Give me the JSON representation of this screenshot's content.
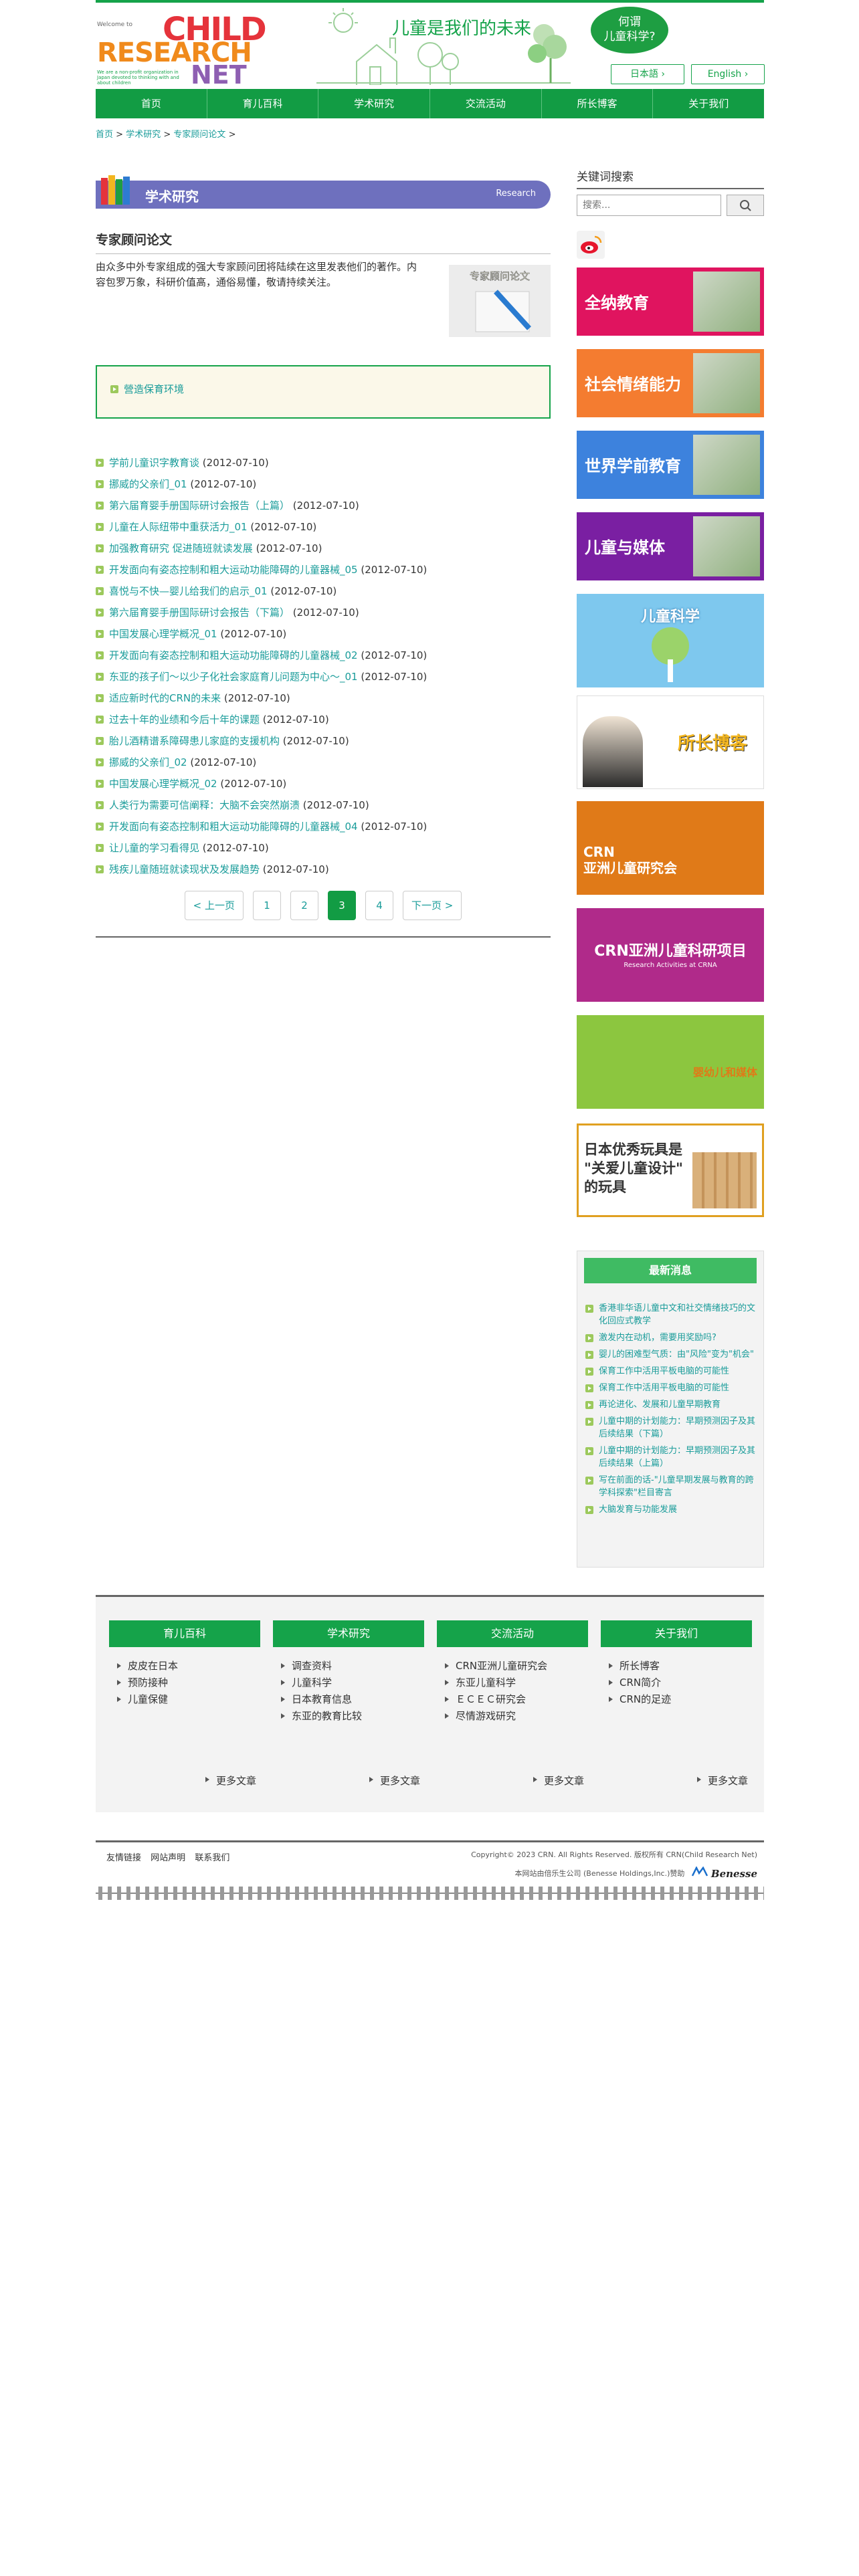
{
  "header": {
    "welcome": "Welcome to",
    "logo_line1": "CHILD",
    "logo_line2": "RESEARCH",
    "logo_line3": "NET",
    "tagline": "We are a non-profit organization in Japan devoted to thinking with and about children",
    "slogan": "儿童是我们的未来",
    "bubble": "何谓\n儿童科学?",
    "lang_jp": "日本語",
    "lang_en": "English"
  },
  "nav": [
    "首页",
    "育儿百科",
    "学术研究",
    "交流活动",
    "所长博客",
    "关于我们"
  ],
  "breadcrumb": {
    "home": "首页",
    "academic": "学术研究",
    "current": "专家顾问论文",
    "sep": ">"
  },
  "section": {
    "title": "学术研究",
    "title_en": "Research"
  },
  "page": {
    "subtitle": "专家顾问论文",
    "intro": "由众多中外专家组成的强大专家顾问团将陆续在这里发表他们的著作。内容包罗万象，科研价值高，通俗易懂，敬请持续关注。",
    "intro_pic_label": "专家顾问论文",
    "box_link": "營造保育环境"
  },
  "articles": [
    {
      "title": "学前儿童识字教育谈",
      "date": "(2012-07-10)"
    },
    {
      "title": "挪威的父亲们_01",
      "date": "(2012-07-10)"
    },
    {
      "title": "第六届育婴手册国际研讨会报告（上篇）",
      "date": "(2012-07-10)"
    },
    {
      "title": "儿童在人际纽带中重获活力_01",
      "date": "(2012-07-10)"
    },
    {
      "title": "加强教育研究 促进随班就读发展",
      "date": "(2012-07-10)"
    },
    {
      "title": "开发面向有姿态控制和粗大运动功能障碍的儿童器械_05",
      "date": "(2012-07-10)"
    },
    {
      "title": "喜悦与不快—婴儿给我们的启示_01",
      "date": "(2012-07-10)"
    },
    {
      "title": "第六届育婴手册国际研讨会报告（下篇）",
      "date": "(2012-07-10)"
    },
    {
      "title": "中国发展心理学概况_01",
      "date": "(2012-07-10)"
    },
    {
      "title": "开发面向有姿态控制和粗大运动功能障碍的儿童器械_02",
      "date": "(2012-07-10)"
    },
    {
      "title": "东亚的孩子们〜以少子化社会家庭育儿问题为中心〜_01",
      "date": "(2012-07-10)"
    },
    {
      "title": "适应新时代的CRN的未来",
      "date": "(2012-07-10)"
    },
    {
      "title": "过去十年的业绩和今后十年的课题",
      "date": "(2012-07-10)"
    },
    {
      "title": "胎儿酒精谱系障碍患儿家庭的支援机构",
      "date": "(2012-07-10)"
    },
    {
      "title": "挪威的父亲们_02",
      "date": "(2012-07-10)"
    },
    {
      "title": "中国发展心理学概况_02",
      "date": "(2012-07-10)"
    },
    {
      "title": "人类行为需要可信阐释：大脑不会突然崩溃",
      "date": "(2012-07-10)"
    },
    {
      "title": "开发面向有姿态控制和粗大运动功能障碍的儿童器械_04",
      "date": "(2012-07-10)"
    },
    {
      "title": "让儿童的学习看得见",
      "date": "(2012-07-10)"
    },
    {
      "title": "残疾儿童随班就读现状及发展趋势",
      "date": "(2012-07-10)"
    }
  ],
  "pager": {
    "prev": "< 上一页",
    "pages": [
      "1",
      "2",
      "3",
      "4"
    ],
    "current": "3",
    "next": "下一页 >"
  },
  "sidebar": {
    "keyword_title": "关键词搜索",
    "search_placeholder": "搜索...",
    "banners": [
      {
        "label": "全纳教育",
        "color": "#e0145f"
      },
      {
        "label": "社会情绪能力",
        "color": "#f47c30"
      },
      {
        "label": "世界学前教育",
        "color": "#3d82dd"
      },
      {
        "label": "儿童与媒体",
        "color": "#7a1fa2"
      },
      {
        "label": "儿童科学",
        "color": "#7ec8ee"
      },
      {
        "label": "所长博客",
        "color": "#ffffff"
      },
      {
        "label": "CRN\n亚洲儿童研究会",
        "color": "#e07a18"
      },
      {
        "label": "CRN亚洲儿童科研项目",
        "sub": "Research Activities at CRNA",
        "color": "#b02a8a"
      },
      {
        "label": "婴幼儿和媒体",
        "color": "#8cc63f"
      },
      {
        "label": "日本优秀玩具是\n\"关爱儿童设计\"\n的玩具",
        "color": "#ffffff"
      }
    ],
    "news_title": "最新消息",
    "news": [
      "香港非华语儿童中文和社交情绪技巧的文化回应式教学",
      "激发内在动机，需要用奖励吗?",
      "婴儿的困难型气质：由\"风险\"变为\"机会\"",
      "保育工作中活用平板电脑的可能性",
      "保育工作中活用平板电脑的可能性",
      "再论进化、发展和儿童早期教育",
      "儿童中期的计划能力：早期预测因子及其后续结果（下篇）",
      "儿童中期的计划能力：早期预测因子及其后续结果（上篇）",
      "写在前面的话-\"儿童早期发展与教育的跨学科探索\"栏目寄言",
      "大脑发育与功能发展"
    ]
  },
  "footer": {
    "columns": [
      {
        "title": "育儿百科",
        "items": [
          "皮皮在日本",
          "预防接种",
          "儿童保健"
        ]
      },
      {
        "title": "学术研究",
        "items": [
          "调查资料",
          "儿童科学",
          "日本教育信息",
          "东亚的教育比较"
        ]
      },
      {
        "title": "交流活动",
        "items": [
          "CRN亚洲儿童研究会",
          "东亚儿童科学",
          "ＥＣＥＣ研究会",
          "尽情游戏研究"
        ]
      },
      {
        "title": "关于我们",
        "items": [
          "所长博客",
          "CRN简介",
          "CRN的足迹"
        ]
      }
    ],
    "more": "更多文章",
    "links": [
      "友情链接",
      "网站声明",
      "联系我们"
    ],
    "copyright": "Copyright© 2023 CRN. All Rights Reserved. 版权所有 CRN(Child Research Net)",
    "support": "本网站由倍乐生公司 (Benesse Holdings,Inc.)赞助",
    "benesse": "Benesse"
  }
}
